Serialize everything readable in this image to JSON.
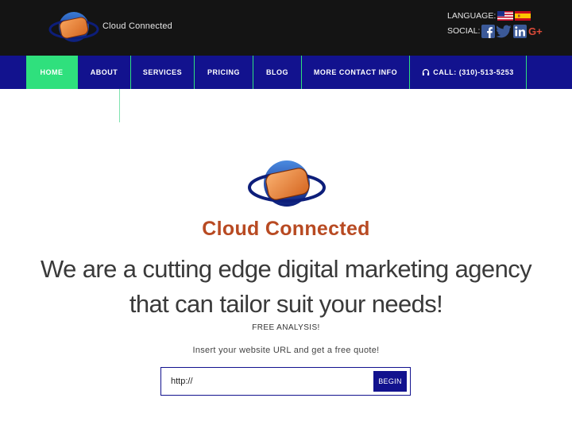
{
  "header": {
    "brand": "Cloud Connected",
    "language_label": "LANGUAGE:",
    "social_label": "SOCIAL:",
    "flags": [
      "us-flag-icon",
      "spain-flag-icon"
    ],
    "social_icons": [
      "facebook-icon",
      "twitter-icon",
      "linkedin-icon",
      "google-plus-icon"
    ]
  },
  "nav": {
    "items": [
      {
        "label": "HOME",
        "active": true
      },
      {
        "label": "ABOUT"
      },
      {
        "label": "SERVICES"
      },
      {
        "label": "PRICING"
      },
      {
        "label": "BLOG"
      },
      {
        "label": "MORE CONTACT INFO"
      },
      {
        "label": "CALL: (310)-513-5253",
        "icon": "headphones-icon"
      }
    ]
  },
  "hero": {
    "brand": "Cloud Connected",
    "headline_line1": "We are a cutting edge digital marketing agency",
    "headline_line2": "that can tailor suit your needs!",
    "free_analysis": "FREE ANALYSIS!",
    "insert_text": "Insert your website URL and get a free quote!"
  },
  "form": {
    "url_value": "http://",
    "button_label": "BEGIN"
  },
  "colors": {
    "nav_bg": "#12128e",
    "active_green": "#2fe07d",
    "brand_orange": "#b84a22",
    "topbar_bg": "#141414"
  }
}
